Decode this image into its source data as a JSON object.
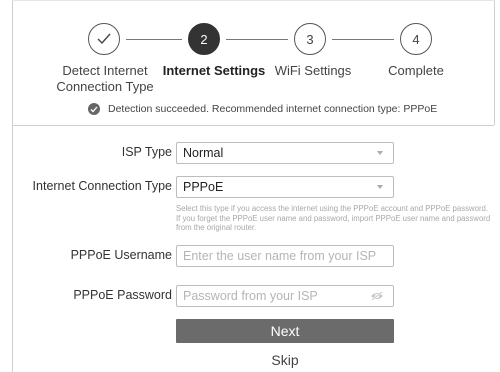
{
  "steps": [
    {
      "number": "",
      "label": "Detect Internet Connection Type",
      "state": "done",
      "icon": "checkmark-icon"
    },
    {
      "number": "2",
      "label": "Internet Settings",
      "state": "active"
    },
    {
      "number": "3",
      "label": "WiFi Settings",
      "state": "pending"
    },
    {
      "number": "4",
      "label": "Complete",
      "state": "pending"
    }
  ],
  "detection": {
    "icon": "check-circle-icon",
    "message": "Detection succeeded. Recommended internet connection type: PPPoE"
  },
  "form": {
    "isp_type": {
      "label": "ISP Type",
      "value": "Normal"
    },
    "connection_type": {
      "label": "Internet Connection Type",
      "value": "PPPoE",
      "help": "Select this type if you access the internet using the PPPoE account and PPPoE password. If you forget the PPPoE user name and password, import PPPoE user name and password from the original router."
    },
    "username": {
      "label": "PPPoE Username",
      "placeholder": "Enter the user name from your ISP"
    },
    "password": {
      "label": "PPPoE Password",
      "placeholder": "Password from your ISP",
      "icon": "eye-hidden-icon"
    }
  },
  "actions": {
    "next_label": "Next",
    "skip_label": "Skip"
  },
  "colors": {
    "active_step": "#333333",
    "button": "#6b6b6b"
  }
}
